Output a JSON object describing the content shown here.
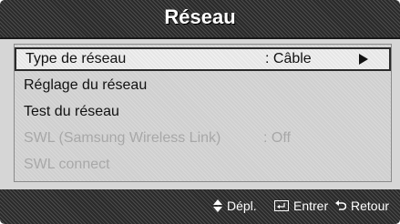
{
  "title": "Réseau",
  "menu": {
    "items": [
      {
        "label": "Type de réseau",
        "value": ": Câble",
        "selected": true,
        "enabled": true,
        "has_arrow": true
      },
      {
        "label": "Réglage du réseau",
        "enabled": true
      },
      {
        "label": "Test du réseau",
        "enabled": true
      },
      {
        "label": "SWL (Samsung Wireless Link)",
        "value": ": Off",
        "enabled": false
      },
      {
        "label": "SWL connect",
        "enabled": false
      }
    ]
  },
  "footer": {
    "move_label": "Dépl.",
    "move_icon": "up-down-arrows-icon",
    "enter_label": "Entrer",
    "enter_icon": "enter-key-icon",
    "return_label": "Retour",
    "return_icon": "return-arrow-icon"
  },
  "colors": {
    "title_bar": "#2a2a2a",
    "menu_background": "#d6d6d6",
    "disabled_text": "#a8a8a8"
  }
}
